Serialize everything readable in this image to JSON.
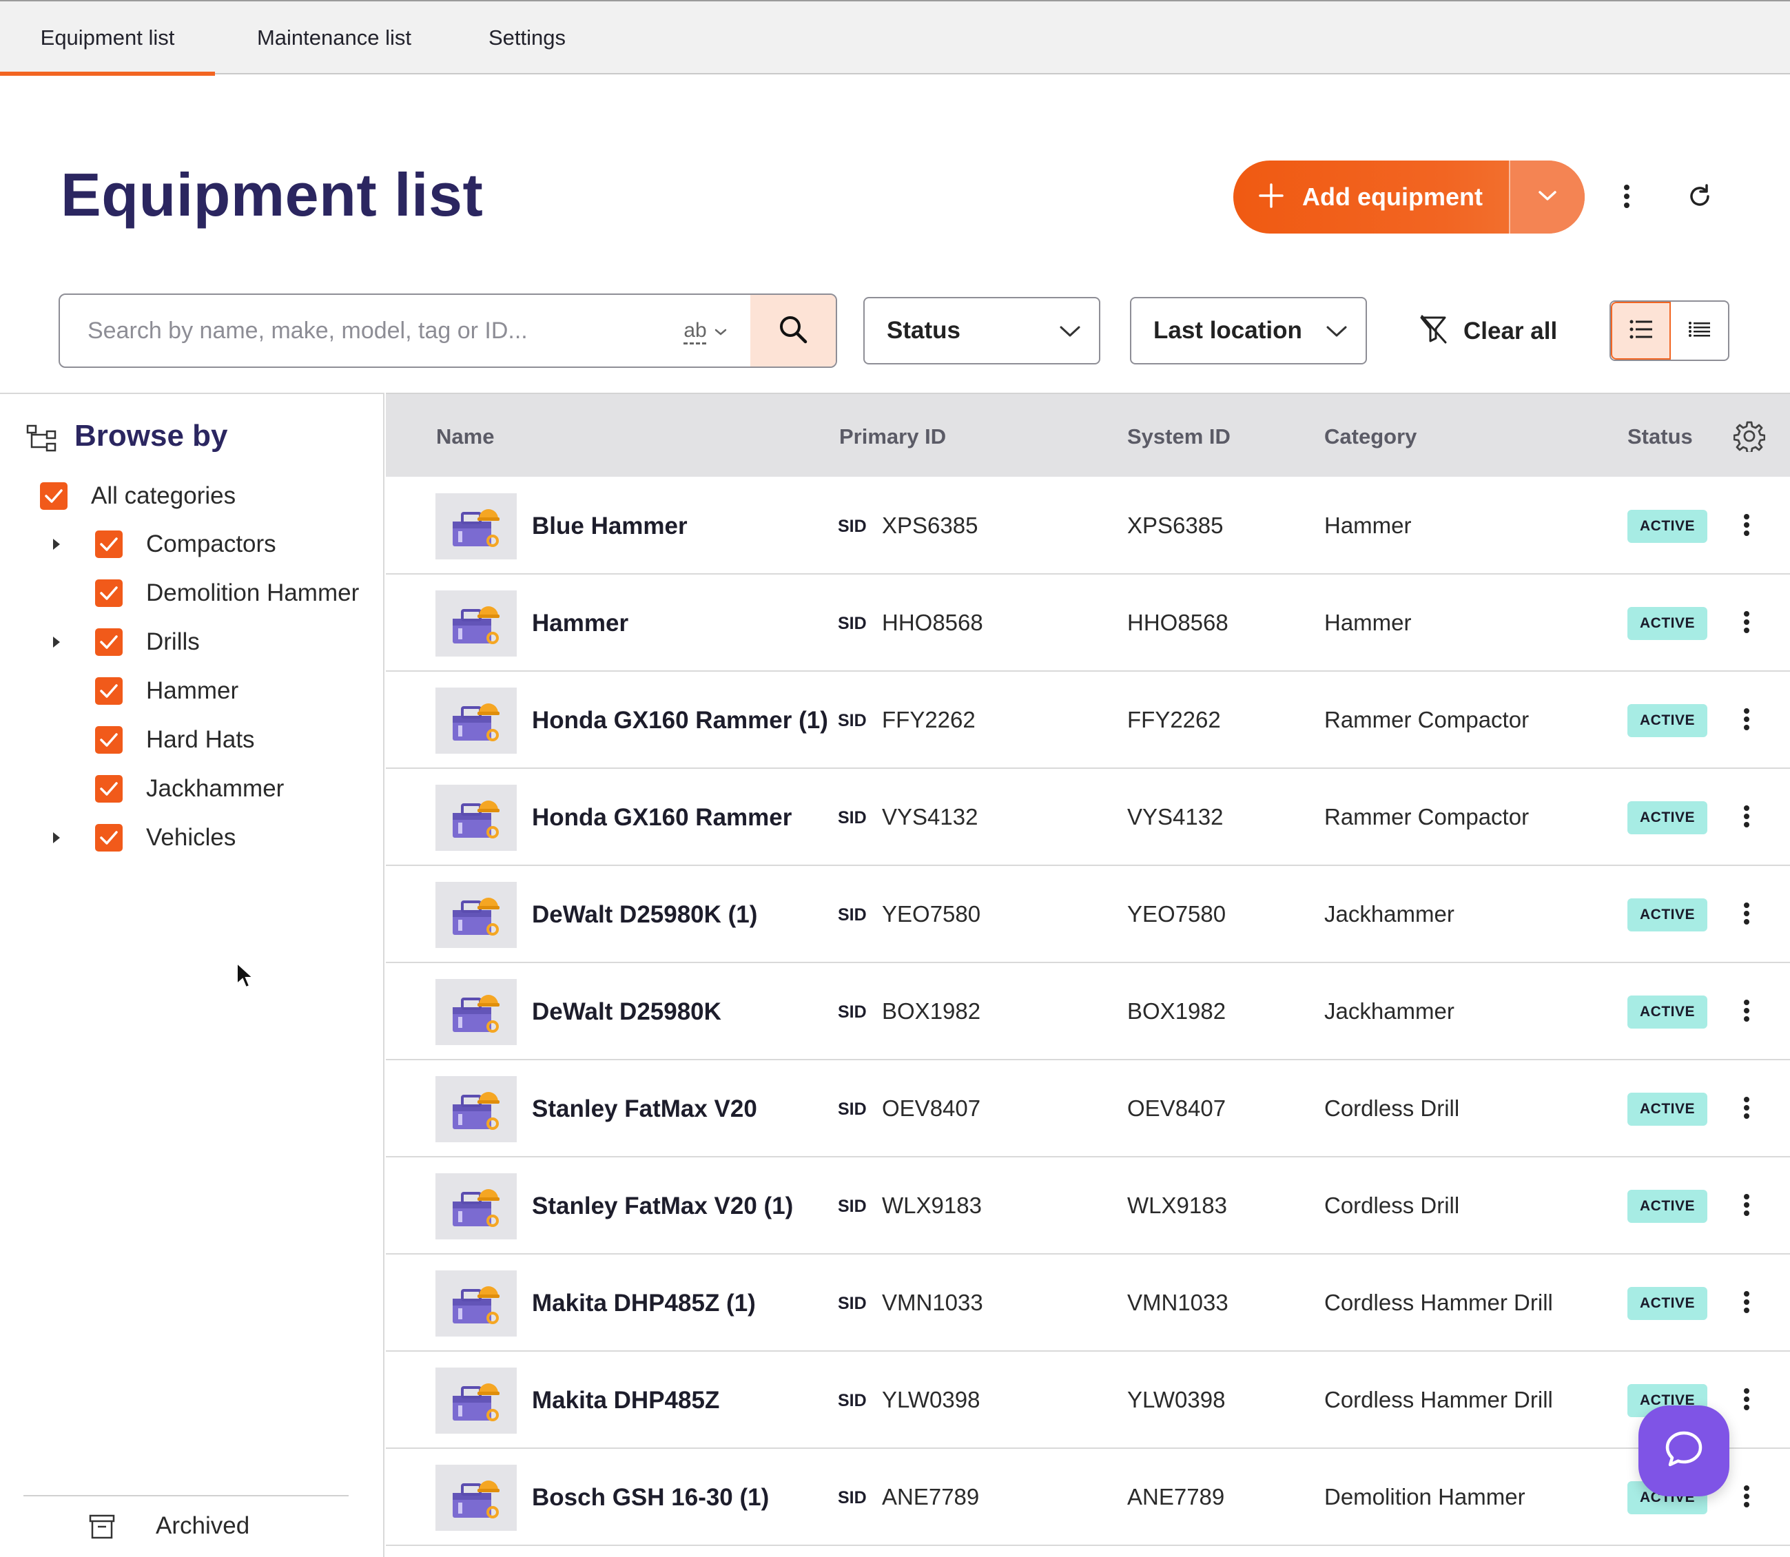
{
  "tabs": [
    {
      "label": "Equipment list",
      "active": true
    },
    {
      "label": "Maintenance list",
      "active": false
    },
    {
      "label": "Settings",
      "active": false
    }
  ],
  "header": {
    "title": "Equipment list",
    "add_label": "Add equipment"
  },
  "filters": {
    "search_placeholder": "Search by name, make, model, tag or ID...",
    "search_mode": "ab",
    "status_label": "Status",
    "location_label": "Last location",
    "clear_label": "Clear all"
  },
  "sidebar": {
    "title": "Browse by",
    "all_label": "All categories",
    "categories": [
      {
        "label": "Compactors",
        "expandable": true
      },
      {
        "label": "Demolition Hammer",
        "expandable": false
      },
      {
        "label": "Drills",
        "expandable": true
      },
      {
        "label": "Hammer",
        "expandable": false
      },
      {
        "label": "Hard Hats",
        "expandable": false
      },
      {
        "label": "Jackhammer",
        "expandable": false
      },
      {
        "label": "Vehicles",
        "expandable": true
      }
    ],
    "archived_label": "Archived"
  },
  "table": {
    "columns": {
      "name": "Name",
      "primary_id": "Primary ID",
      "system_id": "System ID",
      "category": "Category",
      "status": "Status"
    },
    "sid_tag": "SID",
    "rows": [
      {
        "name": "Blue Hammer",
        "primary_id": "XPS6385",
        "system_id": "XPS6385",
        "category": "Hammer",
        "status": "ACTIVE"
      },
      {
        "name": "Hammer",
        "primary_id": "HHO8568",
        "system_id": "HHO8568",
        "category": "Hammer",
        "status": "ACTIVE"
      },
      {
        "name": "Honda GX160 Rammer (1)",
        "primary_id": "FFY2262",
        "system_id": "FFY2262",
        "category": "Rammer Compactor",
        "status": "ACTIVE"
      },
      {
        "name": "Honda GX160 Rammer",
        "primary_id": "VYS4132",
        "system_id": "VYS4132",
        "category": "Rammer Compactor",
        "status": "ACTIVE"
      },
      {
        "name": "DeWalt D25980K (1)",
        "primary_id": "YEO7580",
        "system_id": "YEO7580",
        "category": "Jackhammer",
        "status": "ACTIVE"
      },
      {
        "name": "DeWalt D25980K",
        "primary_id": "BOX1982",
        "system_id": "BOX1982",
        "category": "Jackhammer",
        "status": "ACTIVE"
      },
      {
        "name": "Stanley FatMax V20",
        "primary_id": "OEV8407",
        "system_id": "OEV8407",
        "category": "Cordless Drill",
        "status": "ACTIVE"
      },
      {
        "name": "Stanley FatMax V20 (1)",
        "primary_id": "WLX9183",
        "system_id": "WLX9183",
        "category": "Cordless Drill",
        "status": "ACTIVE"
      },
      {
        "name": "Makita DHP485Z (1)",
        "primary_id": "VMN1033",
        "system_id": "VMN1033",
        "category": "Cordless Hammer Drill",
        "status": "ACTIVE"
      },
      {
        "name": "Makita DHP485Z",
        "primary_id": "YLW0398",
        "system_id": "YLW0398",
        "category": "Cordless Hammer Drill",
        "status": "ACTIVE"
      },
      {
        "name": "Bosch GSH 16-30 (1)",
        "primary_id": "ANE7789",
        "system_id": "ANE7789",
        "category": "Demolition Hammer",
        "status": "ACTIVE"
      }
    ]
  },
  "colors": {
    "accent": "#f26522",
    "title": "#2b2660",
    "status_active": "#a7ece4",
    "chat": "#7f54e6"
  },
  "icons": [
    "plus-icon",
    "chevron-down-icon",
    "kebab-icon",
    "refresh-icon",
    "search-icon",
    "filter-clear-icon",
    "list-view-icon",
    "compact-list-icon",
    "tree-icon",
    "checkbox-icon",
    "caret-right-icon",
    "archive-icon",
    "gear-icon",
    "equipment-thumbnail-icon",
    "chat-icon",
    "cursor-icon"
  ]
}
